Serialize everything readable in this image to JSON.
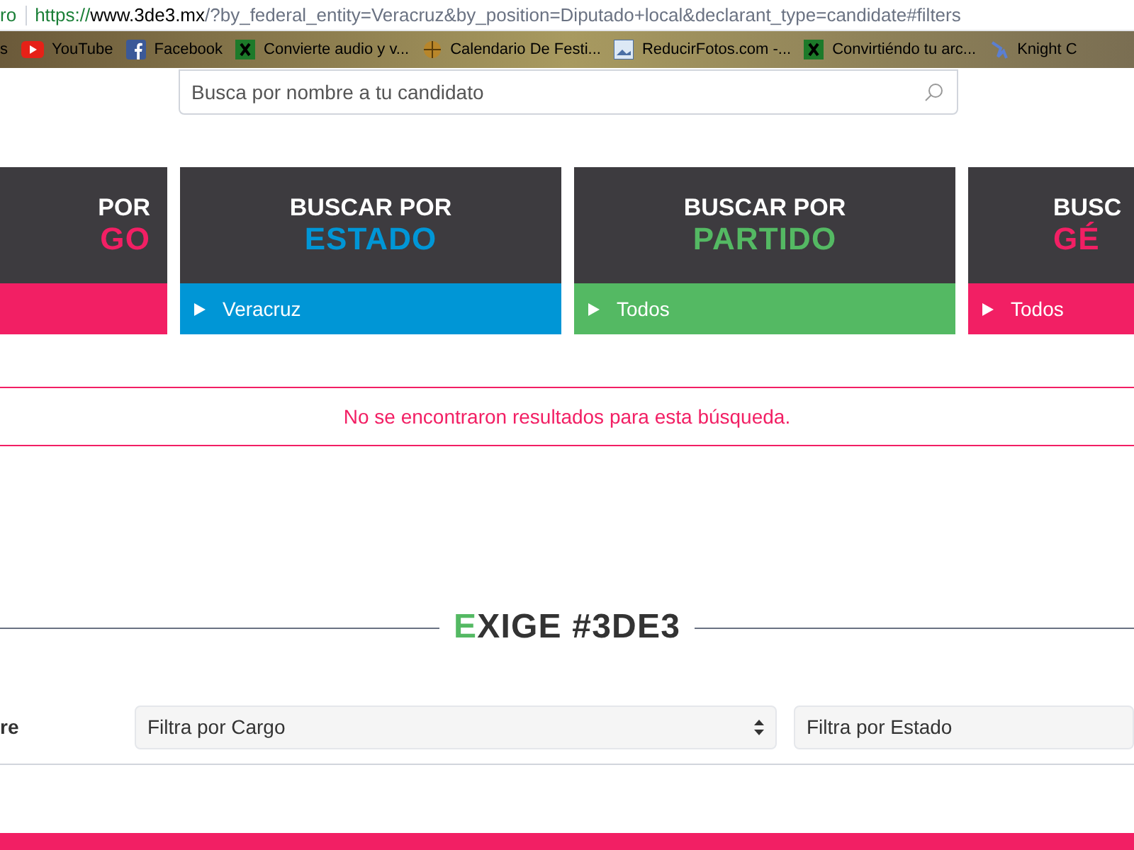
{
  "address_bar": {
    "prefix": "ro",
    "host": "https://www.3de3.mx/",
    "path": "?by_federal_entity=Veracruz&by_position=Diputado+local&declarant_type=candidate#filters"
  },
  "bookmarks": [
    {
      "label": "s",
      "kind": "text"
    },
    {
      "label": "YouTube",
      "kind": "youtube"
    },
    {
      "label": "Facebook",
      "kind": "facebook"
    },
    {
      "label": "Convierte audio y v...",
      "kind": "green"
    },
    {
      "label": "Calendario De Festi...",
      "kind": "globe"
    },
    {
      "label": "ReducirFotos.com -...",
      "kind": "photo"
    },
    {
      "label": "Convirtiéndo tu arc...",
      "kind": "green"
    },
    {
      "label": "Knight C",
      "kind": "knight"
    }
  ],
  "search": {
    "placeholder": "Busca por nombre a tu candidato"
  },
  "filter_cards": [
    {
      "title": "POR",
      "word": "GO",
      "color": "#f21f64"
    },
    {
      "title": "BUSCAR POR",
      "word": "ESTADO",
      "value": "Veracruz",
      "color": "#0096d6"
    },
    {
      "title": "BUSCAR POR",
      "word": "PARTIDO",
      "value": "Todos",
      "color": "#54b963"
    },
    {
      "title": "BUSC",
      "word": "GÉ",
      "value": "Todos",
      "color": "#f21f64"
    }
  ],
  "message": "No se encontraron resultados para esta búsqueda.",
  "section_title": {
    "accent": "E",
    "rest": "XIGE #3DE3"
  },
  "filters": {
    "label": "re",
    "selects": [
      {
        "value": "Filtra por Cargo"
      },
      {
        "value": "Filtra por Estado"
      }
    ]
  }
}
